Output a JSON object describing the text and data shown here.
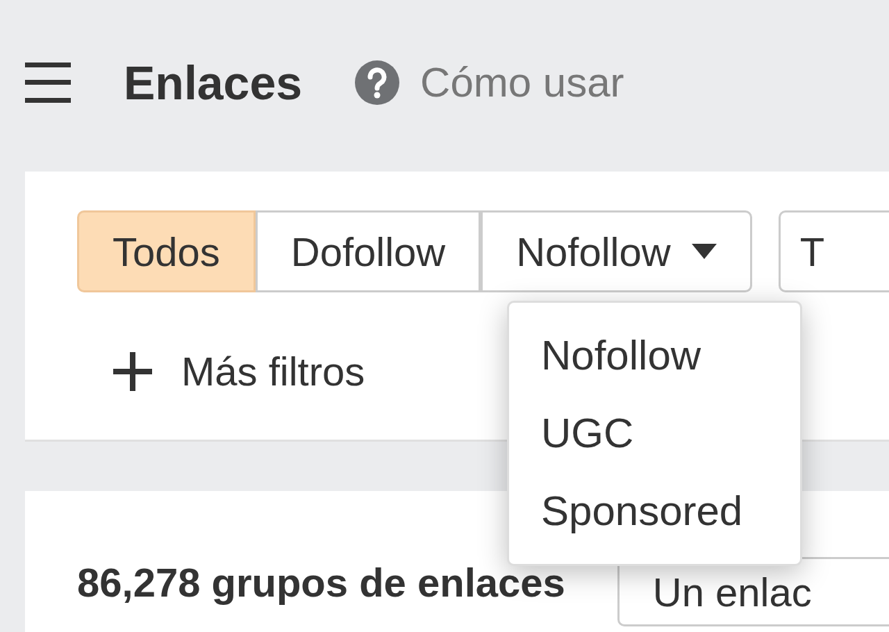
{
  "header": {
    "title": "Enlaces",
    "help_link": "Cómo usar"
  },
  "filters": {
    "link_type": [
      {
        "label": "Todos",
        "selected": true,
        "kind": "option"
      },
      {
        "label": "Dofollow",
        "selected": false,
        "kind": "option"
      },
      {
        "label": "Nofollow",
        "selected": false,
        "kind": "dropdown"
      }
    ],
    "next_button": "T",
    "more_filters": "Más filtros"
  },
  "dropdown": {
    "items": [
      {
        "label": "Nofollow"
      },
      {
        "label": "UGC"
      },
      {
        "label": "Sponsored"
      }
    ]
  },
  "results": {
    "count": "86,278 grupos de enlaces",
    "grouping_button": "Un enlac"
  }
}
